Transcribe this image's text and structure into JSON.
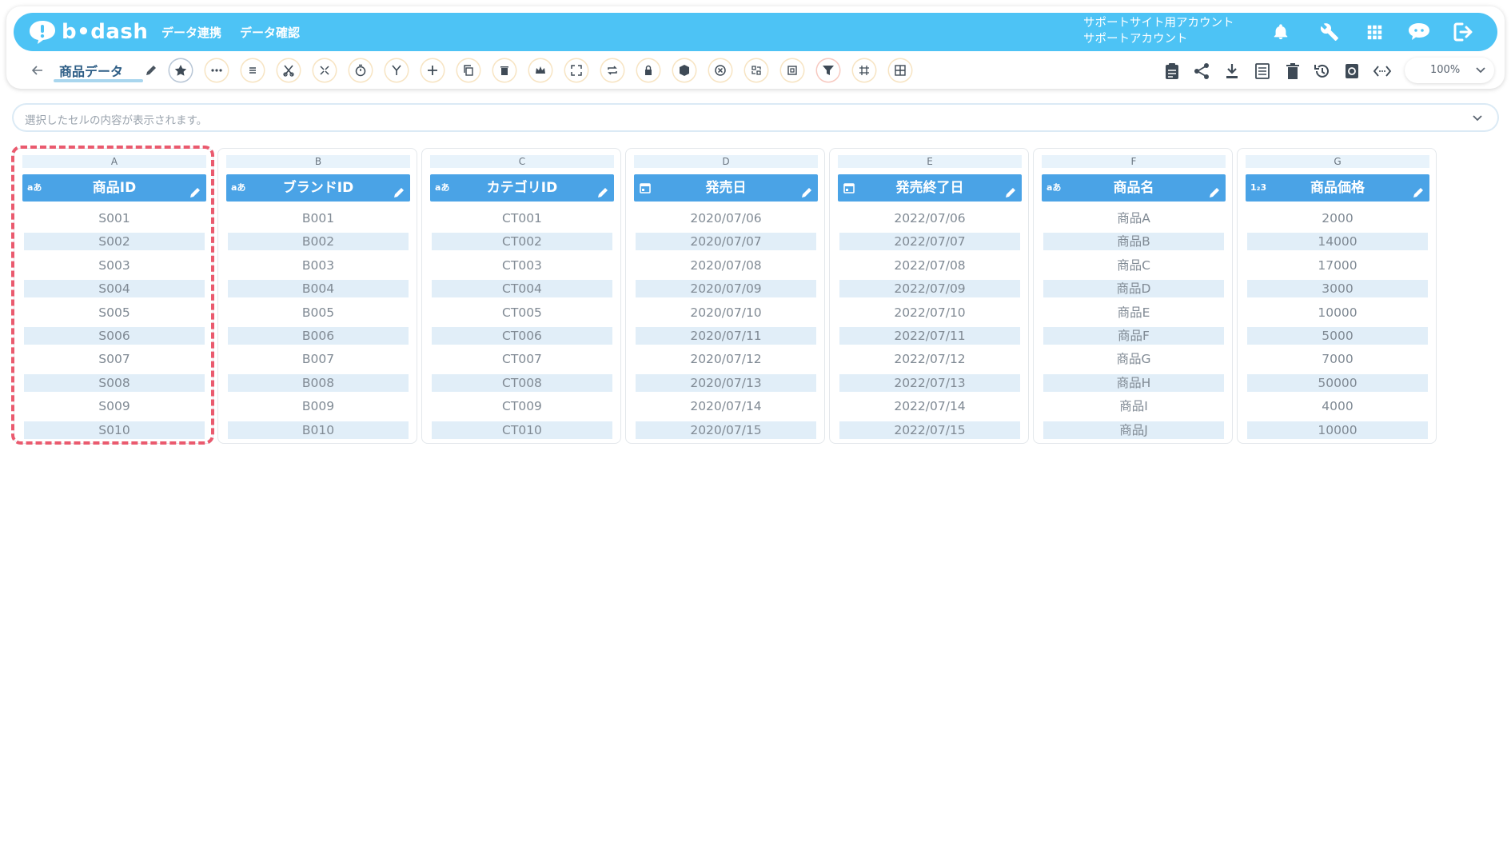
{
  "header": {
    "logo_text": "b•dash",
    "nav": [
      "データ連携",
      "データ確認"
    ],
    "account_line1": "サポートサイト用アカウント",
    "account_line2": "サポートアカウント",
    "icons": [
      "bell-icon",
      "wrench-icon",
      "grid-icon",
      "chat-icon",
      "logout-icon"
    ]
  },
  "toolbar": {
    "title": "商品データ",
    "tools": [
      "star-icon",
      "more-icon",
      "list-icon",
      "scissors-icon",
      "split-icon",
      "timer-icon",
      "merge-icon",
      "plus-icon",
      "copy-icon",
      "trash-icon",
      "crown-icon",
      "expand-icon",
      "repeat-icon",
      "lock-icon",
      "box-icon",
      "cancel-icon",
      "transform-icon",
      "frame-icon",
      "filter-icon",
      "pattern-icon",
      "table-icon"
    ],
    "right_icons": [
      "clipboard-icon",
      "share-icon",
      "download-icon",
      "sheet-icon",
      "delete-icon",
      "history-icon",
      "refresh-icon",
      "code-icon"
    ],
    "zoom": "100%"
  },
  "cell_bar": {
    "placeholder": "選択したセルの内容が表示されます。"
  },
  "columns": [
    {
      "letter": "A",
      "name": "商品ID",
      "type": "aあ",
      "rows": [
        "S001",
        "S002",
        "S003",
        "S004",
        "S005",
        "S006",
        "S007",
        "S008",
        "S009",
        "S010"
      ]
    },
    {
      "letter": "B",
      "name": "ブランドID",
      "type": "aあ",
      "rows": [
        "B001",
        "B002",
        "B003",
        "B004",
        "B005",
        "B006",
        "B007",
        "B008",
        "B009",
        "B010"
      ]
    },
    {
      "letter": "C",
      "name": "カテゴリID",
      "type": "aあ",
      "rows": [
        "CT001",
        "CT002",
        "CT003",
        "CT004",
        "CT005",
        "CT006",
        "CT007",
        "CT008",
        "CT009",
        "CT010"
      ]
    },
    {
      "letter": "D",
      "name": "発売日",
      "type": "calendar-icon",
      "rows": [
        "2020/07/06",
        "2020/07/07",
        "2020/07/08",
        "2020/07/09",
        "2020/07/10",
        "2020/07/11",
        "2020/07/12",
        "2020/07/13",
        "2020/07/14",
        "2020/07/15"
      ]
    },
    {
      "letter": "E",
      "name": "発売終了日",
      "type": "calendar-icon",
      "rows": [
        "2022/07/06",
        "2022/07/07",
        "2022/07/08",
        "2022/07/09",
        "2022/07/10",
        "2022/07/11",
        "2022/07/12",
        "2022/07/13",
        "2022/07/14",
        "2022/07/15"
      ]
    },
    {
      "letter": "F",
      "name": "商品名",
      "type": "aあ",
      "rows": [
        "商品A",
        "商品B",
        "商品C",
        "商品D",
        "商品E",
        "商品F",
        "商品G",
        "商品H",
        "商品I",
        "商品J"
      ]
    },
    {
      "letter": "G",
      "name": "商品価格",
      "type": "1₂3",
      "rows": [
        "2000",
        "14000",
        "17000",
        "3000",
        "10000",
        "5000",
        "7000",
        "50000",
        "4000",
        "10000"
      ]
    }
  ],
  "colors": {
    "brand": "#4dc3f5",
    "header": "#4aa3e6",
    "row_alt": "#e1eef8",
    "selection": "#ea5a6e"
  }
}
